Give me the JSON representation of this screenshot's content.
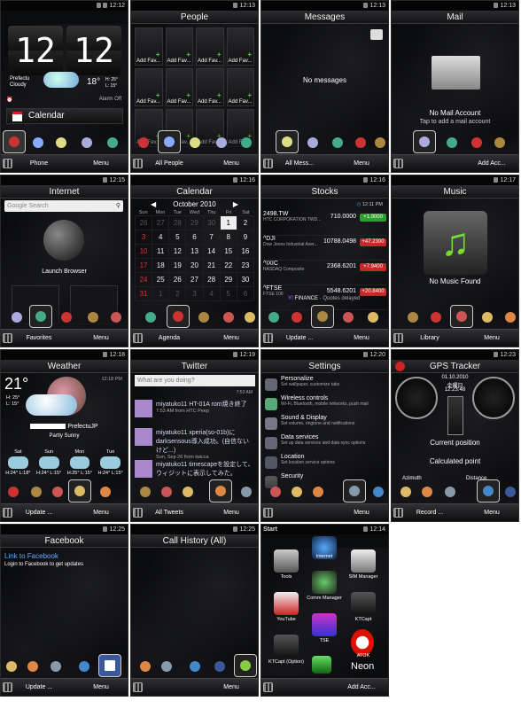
{
  "panels": {
    "home": {
      "time": "12:12",
      "title": "",
      "clock": "12:12",
      "location": "Prefectu",
      "condition": "Cloudy",
      "temp": "18°",
      "hi": "H: 25°",
      "lo": "L: 15°",
      "alarm": "Alarm Off",
      "calendar_label": "Calendar",
      "tab_left": "Phone",
      "tab_right": "Menu"
    },
    "people": {
      "time": "12:13",
      "title": "People",
      "fav_label": "Add Fav...",
      "tab_left": "All People",
      "tab_right": "Menu"
    },
    "messages": {
      "time": "12:13",
      "title": "Messages",
      "empty": "No messages",
      "tab_left": "All Mess...",
      "tab_right": "Menu"
    },
    "mail": {
      "time": "12:13",
      "title": "Mail",
      "empty": "No Mail Account",
      "hint": "Tap to add a mail account",
      "tab_right": "Add Acc..."
    },
    "internet": {
      "time": "12:15",
      "title": "Internet",
      "search_placeholder": "Google Search",
      "launch": "Launch Browser",
      "tab_left": "Favorites",
      "tab_right": "Menu"
    },
    "calendar": {
      "time": "12:16",
      "title": "Calendar",
      "month": "October 2010",
      "weekdays": [
        "Sun",
        "Mon",
        "Tue",
        "Wed",
        "Thu",
        "Fri",
        "Sat"
      ],
      "weeks": [
        [
          "26",
          "27",
          "28",
          "29",
          "30",
          "1",
          "2"
        ],
        [
          "3",
          "4",
          "5",
          "6",
          "7",
          "8",
          "9"
        ],
        [
          "10",
          "11",
          "12",
          "13",
          "14",
          "15",
          "16"
        ],
        [
          "17",
          "18",
          "19",
          "20",
          "21",
          "22",
          "23"
        ],
        [
          "24",
          "25",
          "26",
          "27",
          "28",
          "29",
          "30"
        ],
        [
          "31",
          "1",
          "2",
          "3",
          "4",
          "5",
          "6"
        ]
      ],
      "tab_left": "Agenda",
      "tab_right": "Menu"
    },
    "stocks": {
      "time": "12:16",
      "title": "Stocks",
      "clock": "12:11 PM",
      "rows": [
        {
          "sym": "2498.TW",
          "name": "HTC CORPORATION TWD...",
          "price": "710.0000",
          "chg": "+1.0000"
        },
        {
          "sym": "^DJI",
          "name": "Dow Jones Industrial Aver...",
          "price": "10788.0498",
          "chg": "+47.2300"
        },
        {
          "sym": "^IXIC",
          "name": "NASDAQ Composite",
          "price": "2368.6201",
          "chg": "+7.9400"
        },
        {
          "sym": "^FTSE",
          "name": "FTSE 100",
          "price": "5548.6201",
          "chg": "+20.8400"
        }
      ],
      "source": "FINANCE",
      "note": "Quotes delayed",
      "tab_left": "Update ...",
      "tab_right": "Menu"
    },
    "music": {
      "time": "12:17",
      "title": "Music",
      "empty": "No Music Found",
      "tab_left": "Library",
      "tab_right": "Menu"
    },
    "weather": {
      "time": "12:18",
      "title": "Weather",
      "temp": "21°",
      "hi": "H: 25°",
      "lo": "L: 15°",
      "updated": "12:18 PM",
      "city": "PrefectuJP",
      "condition": "Partly Sunny",
      "days": [
        {
          "d": "Sat",
          "h": "H:24°",
          "l": "L:18°"
        },
        {
          "d": "Sun",
          "h": "H:24°",
          "l": "L:15°"
        },
        {
          "d": "Mon",
          "h": "H:25°",
          "l": "L:15°"
        },
        {
          "d": "Tue",
          "h": "H:24°",
          "l": "L:15°"
        }
      ],
      "tab_left": "Update ...",
      "tab_right": "Menu"
    },
    "twitter": {
      "time": "12:19",
      "title": "Twitter",
      "placeholder": "What are you doing?",
      "t0": "7:53 AM",
      "tweets": [
        {
          "text": "miyatuko11 HT-01A rom焼き終了",
          "meta": "7:53 AM from HTC Peep"
        },
        {
          "text": "miyatuko11 xperia(so-01b)にdarksensous導入成功。(自信ないけど...)",
          "meta": "Sun, Sep 26 from twicca"
        },
        {
          "text": "miyatuko11 timescapeを設定して、ウィジットに表示してみた。",
          "meta": ""
        }
      ],
      "tab_left": "All Tweets",
      "tab_right": "Menu"
    },
    "settings": {
      "time": "12:20",
      "title": "Settings",
      "items": [
        {
          "t": "Personalize",
          "d": "Set wallpaper, customize tabs"
        },
        {
          "t": "Wireless controls",
          "d": "Wi-Fi, Bluetooth, mobile networks, push mail"
        },
        {
          "t": "Sound & Display",
          "d": "Set volume, ringtone and notifications"
        },
        {
          "t": "Data services",
          "d": "Set up data services and data sync options"
        },
        {
          "t": "Location",
          "d": "Set location service options"
        },
        {
          "t": "Security",
          "d": ""
        }
      ],
      "tab_right": "Menu"
    },
    "gps": {
      "time": "12:23",
      "title": "GPS Tracker",
      "date": "01.10.2010",
      "day": "金曜日",
      "clock": "12:23:48",
      "current": "Current position",
      "calc": "Calculated point",
      "azimuth": "Azimuth",
      "distance": "Distance",
      "tab_left": "Record ...",
      "tab_right": "Menu"
    },
    "facebook": {
      "time": "12:25",
      "title": "Facebook",
      "link": "Link to Facebook",
      "hint": "Login to Facebook to get updates",
      "tab_left": "Update ...",
      "tab_right": "Menu"
    },
    "callhistory": {
      "time": "12:25",
      "title": "Call History (All)",
      "tab_right": "Menu"
    },
    "start": {
      "time": "12:14",
      "title": "Start",
      "tiles": [
        {
          "label": "Internet"
        },
        {
          "label": "Tools"
        },
        {
          "label": "SIM Manager"
        },
        {
          "label": "Comm Manager"
        },
        {
          "label": "YouTube"
        },
        {
          "label": "KTCapt"
        },
        {
          "label": "TSE"
        },
        {
          "label": "KTCapt (Option)"
        },
        {
          "label": "ATOK"
        },
        {
          "label": "Neon"
        }
      ],
      "tab_right": "Add Acc..."
    }
  },
  "colors": {
    "accent": "#1e6fd0",
    "green": "#22aa22",
    "red": "#cc2222",
    "pill_green": "#2e9e2e",
    "pill_red": "#c62828"
  }
}
